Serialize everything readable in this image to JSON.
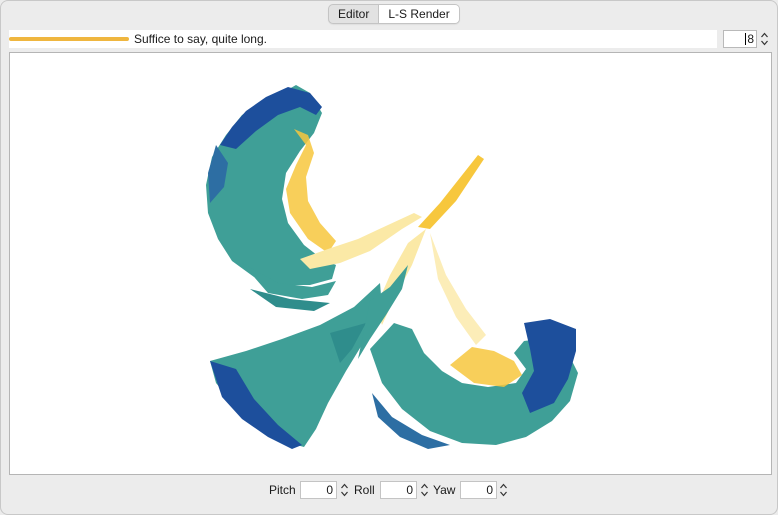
{
  "tabs": [
    {
      "label": "Editor",
      "selected": false
    },
    {
      "label": "L-S Render",
      "selected": true
    }
  ],
  "progress": {
    "fraction": 1.0,
    "message": "Suffice to say, quite long.",
    "color": "#efb63f"
  },
  "depth": {
    "value": "8"
  },
  "controls": {
    "pitch": {
      "label": "Pitch",
      "value": "0"
    },
    "roll": {
      "label": "Roll",
      "value": "0"
    },
    "yaw": {
      "label": "Yaw",
      "value": "0"
    }
  },
  "render": {
    "colors": {
      "trunk": "#f7c73d",
      "teal": "#3f9f97",
      "blue": "#1d4f9c",
      "deep-blue": "#1a3f99",
      "light-yellow": "#fbe9a6"
    }
  }
}
